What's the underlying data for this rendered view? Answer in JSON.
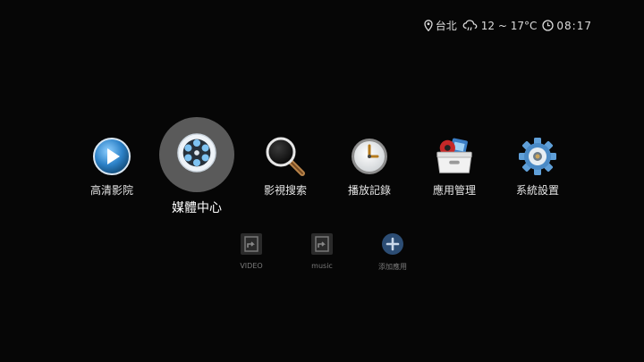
{
  "status": {
    "location": "台北",
    "weather": "12 ~ 17°C",
    "time": "08:17"
  },
  "apps": [
    {
      "label": "高清影院",
      "icon": "play-icon"
    },
    {
      "label": "媒體中心",
      "icon": "film-reel-icon",
      "focused": true
    },
    {
      "label": "影視搜索",
      "icon": "magnifier-icon"
    },
    {
      "label": "播放記錄",
      "icon": "clock-icon"
    },
    {
      "label": "應用管理",
      "icon": "app-box-icon"
    },
    {
      "label": "系統設置",
      "icon": "gear-icon"
    }
  ],
  "shortcuts": [
    {
      "label": "VIDEO",
      "icon": "shortcut-arrow-icon"
    },
    {
      "label": "music",
      "icon": "shortcut-arrow-icon"
    },
    {
      "label": "添加應用",
      "icon": "add-icon"
    }
  ],
  "colors": {
    "background": "#060606",
    "focus_ring": "#5a5a5a",
    "accent_blue": "#3f8fd0"
  }
}
